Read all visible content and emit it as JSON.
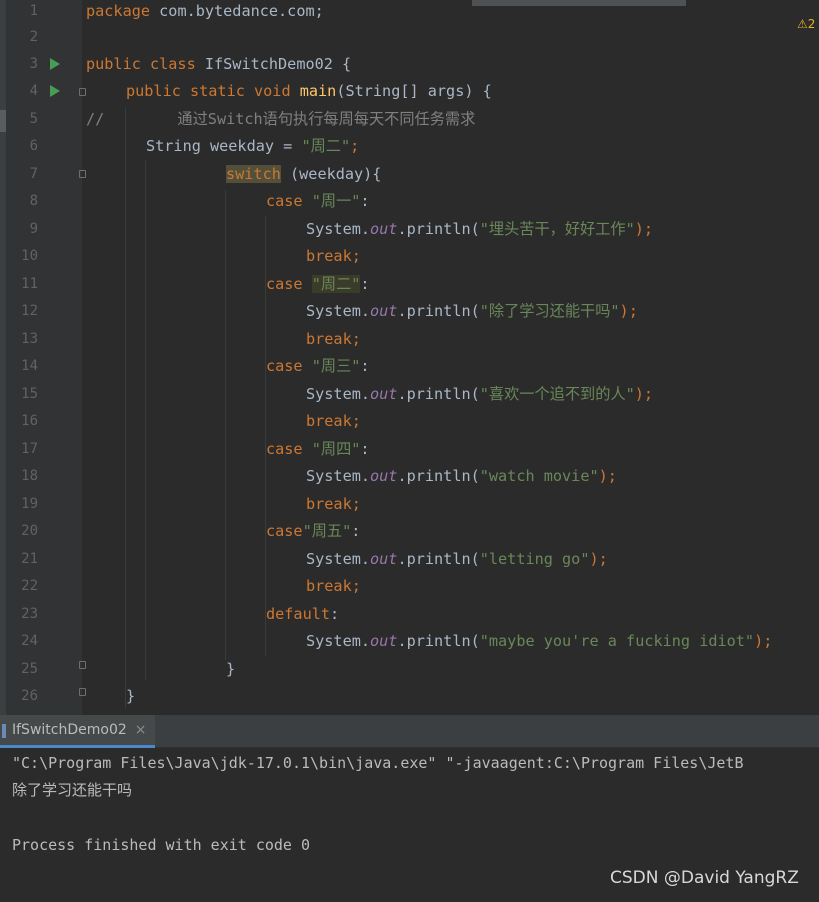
{
  "editor": {
    "line_numbers": [
      "1",
      "2",
      "3",
      "4",
      "5",
      "6",
      "7",
      "8",
      "9",
      "10",
      "11",
      "12",
      "13",
      "14",
      "15",
      "16",
      "17",
      "18",
      "19",
      "20",
      "21",
      "22",
      "23",
      "24",
      "25",
      "26"
    ],
    "code": {
      "l1_kw": "package",
      "l1_rest": " com.bytedance.com;",
      "l3_kw": "public class",
      "l3_rest": " IfSwitchDemo02 {",
      "l4_kw": "public static void",
      "l4_fn": "main",
      "l4_rest": "(String[] args) {",
      "l5_comment": "//        通过Switch语句执行每周每天不同任务需求",
      "l6_pre": "String weekday = ",
      "l6_str": "\"周二\"",
      "l6_post": ";",
      "switch_kw": "switch",
      "l7_rest": " (weekday){",
      "case_kw": "case",
      "break_kw": "break",
      "default_kw": "default",
      "semicolon": ";",
      "colon": ":",
      "system": "System.",
      "out": "out",
      "println": ".println(",
      "close_call": ");",
      "case1": "\"周一\"",
      "case2": "\"周二\"",
      "case3": "\"周三\"",
      "case4": "\"周四\"",
      "case5": "\"周五\"",
      "msg1": "\"埋头苦干，好好工作\"",
      "msg2": "\"除了学习还能干吗\"",
      "msg3": "\"喜欢一个追不到的人\"",
      "msg4": "\"watch movie\"",
      "msg5": "\"letting go\"",
      "msg_default": "\"maybe you're a fucking idiot\"",
      "close_brace": "}"
    },
    "warning_icon": "warning-triangle-icon",
    "warning_symbol": "⚠",
    "warning_count": "2"
  },
  "run_panel": {
    "tab_label": "IfSwitchDemo02",
    "tab_close": "×",
    "console_lines": [
      "\"C:\\Program Files\\Java\\jdk-17.0.1\\bin\\java.exe\" \"-javaagent:C:\\Program Files\\JetB",
      "除了学习还能干吗",
      "",
      "Process finished with exit code 0"
    ]
  },
  "watermark": "CSDN @David YangRZ",
  "colors": {
    "keyword": "#cc7832",
    "string": "#6a8759",
    "comment": "#808080",
    "method": "#ffc66d",
    "static_field": "#9876aa",
    "text": "#a9b7c6",
    "run_arrow": "#499c54"
  }
}
